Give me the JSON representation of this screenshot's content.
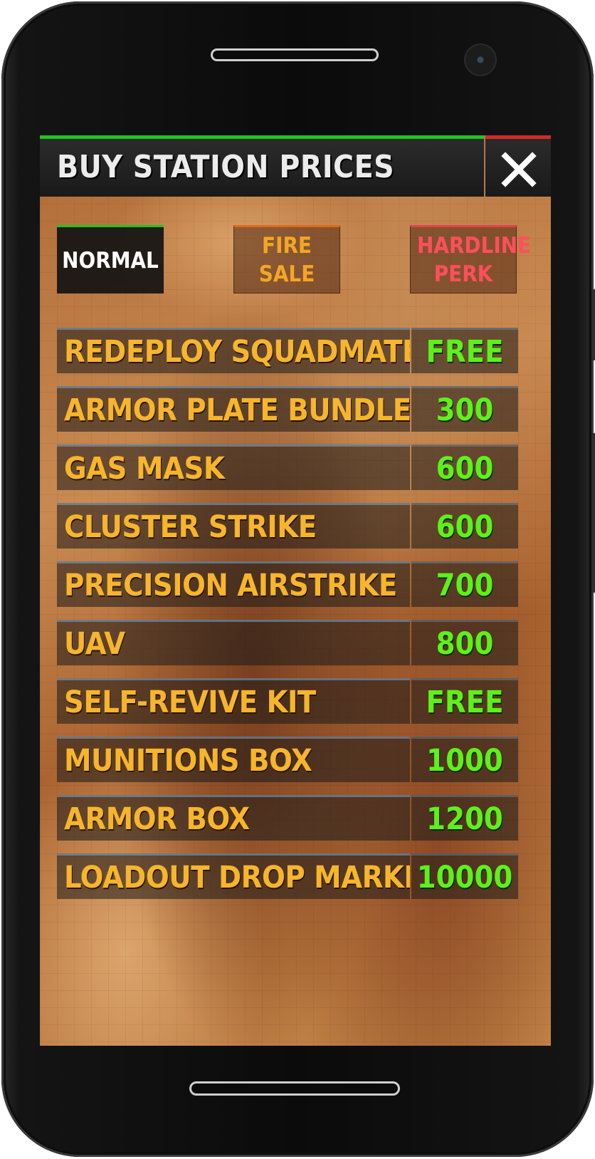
{
  "header": {
    "title": "BUY STATION PRICES",
    "close_icon": "close-icon"
  },
  "tabs": [
    {
      "label": "NORMAL",
      "selected": true,
      "accent": "#1ec41e"
    },
    {
      "label": "FIRE SALE",
      "selected": false,
      "accent": "#e0691b"
    },
    {
      "label": "HARDLINE PERK",
      "selected": false,
      "accent": "#e0434a"
    }
  ],
  "prices": [
    {
      "item": "REDEPLOY SQUADMATE",
      "price": "FREE"
    },
    {
      "item": "ARMOR PLATE BUNDLE",
      "price": "300"
    },
    {
      "item": "GAS MASK",
      "price": "600"
    },
    {
      "item": "CLUSTER STRIKE",
      "price": "600"
    },
    {
      "item": "PRECISION AIRSTRIKE",
      "price": "700"
    },
    {
      "item": "UAV",
      "price": "800"
    },
    {
      "item": "SELF-REVIVE KIT",
      "price": "FREE"
    },
    {
      "item": "MUNITIONS BOX",
      "price": "1000"
    },
    {
      "item": "ARMOR BOX",
      "price": "1200"
    },
    {
      "item": "LOADOUT DROP MARKER",
      "price": "10000"
    }
  ],
  "colors": {
    "item_text": "#f6b52c",
    "price_text": "#5ef01a",
    "header_accent": "#1ec41e",
    "close_accent": "#d42a2a"
  }
}
